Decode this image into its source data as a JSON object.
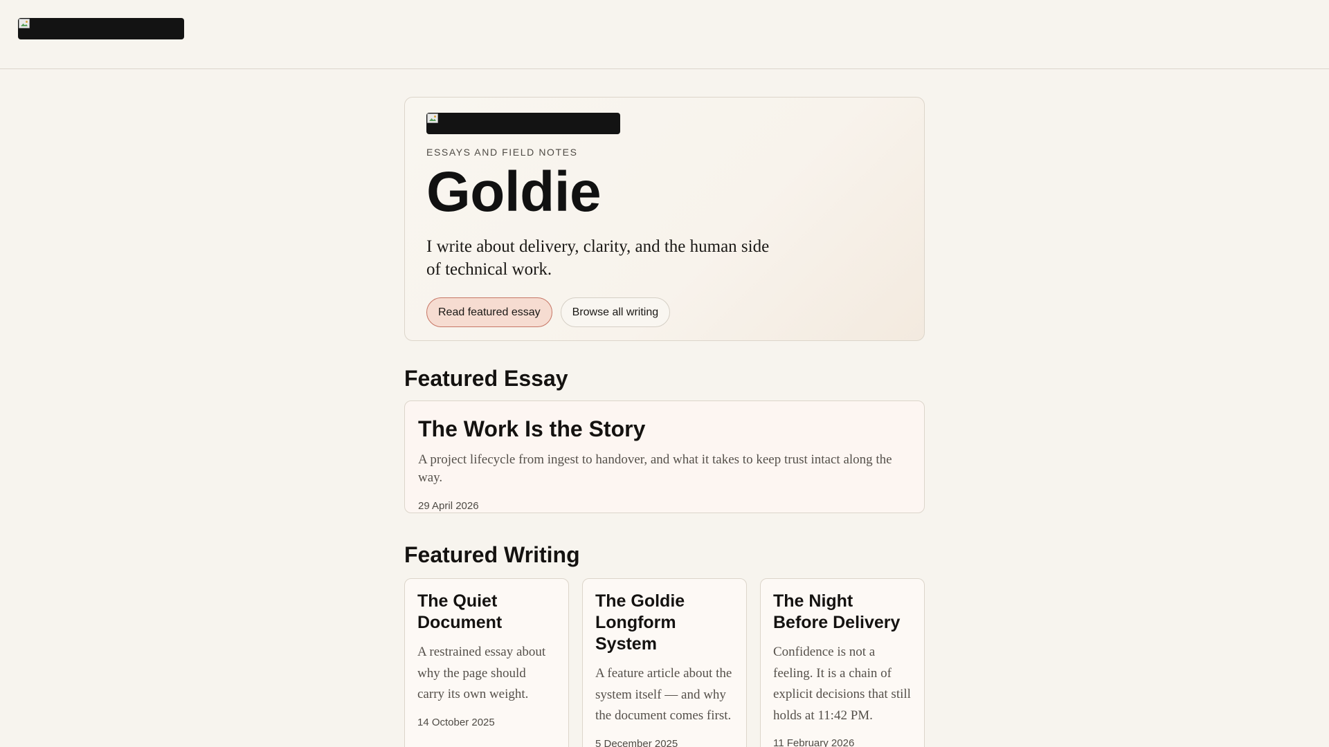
{
  "header": {
    "logo_alt": ""
  },
  "hero": {
    "kicker": "ESSAYS AND FIELD NOTES",
    "title": "Goldie",
    "tagline": "I write about delivery, clarity, and the human side of technical work.",
    "primary_button": "Read featured essay",
    "secondary_button": "Browse all writing"
  },
  "featured_essay": {
    "heading": "Featured Essay",
    "title": "The Work Is the Story",
    "summary": "A project lifecycle from ingest to handover, and what it takes to keep trust intact along the way.",
    "date": "29 April 2026"
  },
  "featured_writing": {
    "heading": "Featured Writing",
    "posts": [
      {
        "title": "The Quiet Document",
        "summary": "A restrained essay about why the page should carry its own weight.",
        "date": "14 October 2025"
      },
      {
        "title": "The Goldie Longform System",
        "summary": "A feature article about the system itself — and why the document comes first.",
        "date": "5 December 2025"
      },
      {
        "title": "The Night Before Delivery",
        "summary": "Confidence is not a feeling. It is a chain of explicit decisions that still holds at 11:42 PM.",
        "date": "11 February 2026"
      }
    ]
  },
  "icons": {
    "broken_image": "broken-image-icon"
  },
  "colors": {
    "background": "#f7f4ee",
    "logo_block": "#131313",
    "primary_button_bg": "#f6dcd1",
    "primary_button_border": "#c67564",
    "featured_card_bg": "#fdf6f2"
  }
}
